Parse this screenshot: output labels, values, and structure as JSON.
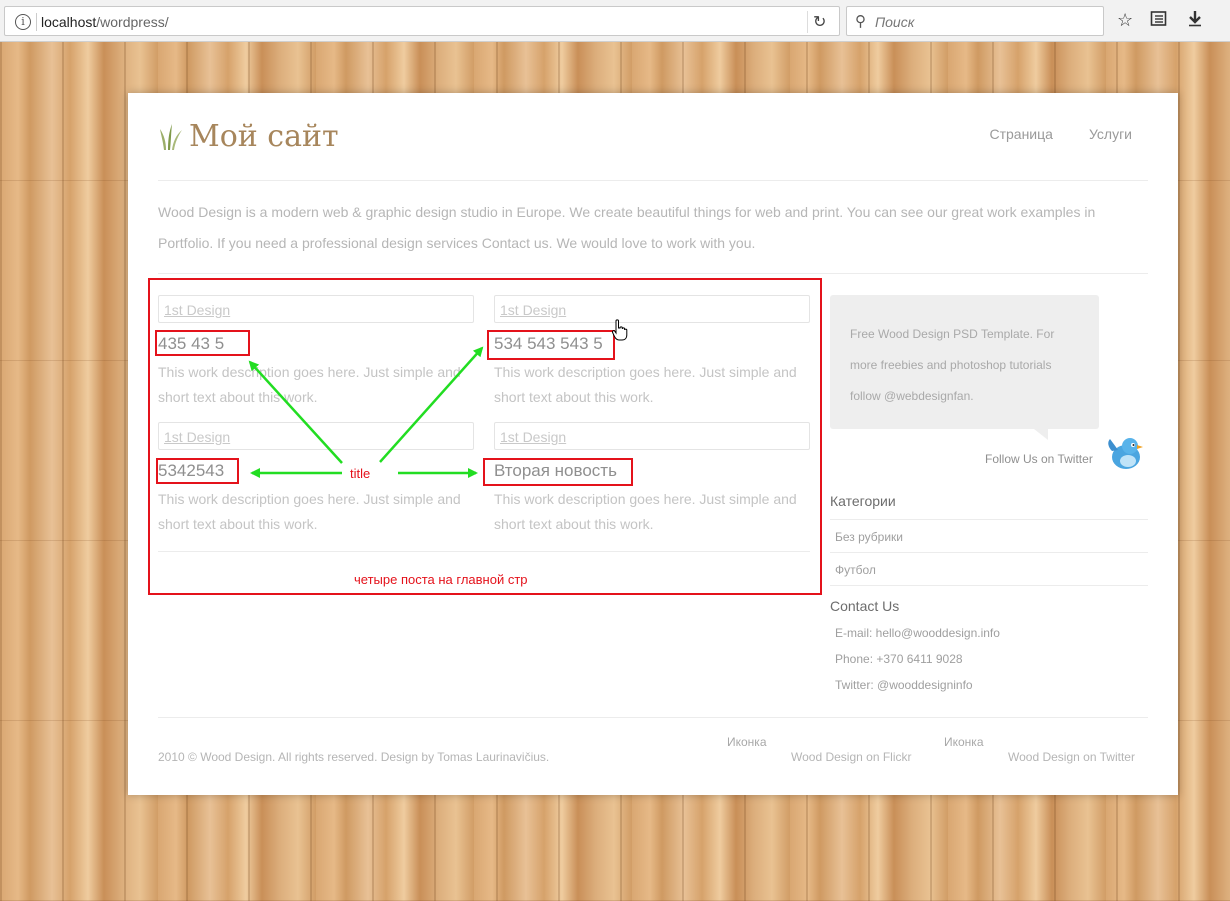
{
  "browser": {
    "url_host": "localhost",
    "url_path": "/wordpress/",
    "search_placeholder": "Поиск",
    "info_glyph": "i",
    "reload_glyph": "↻",
    "search_glyph": "⚲",
    "icons": [
      "star-icon",
      "reading-list-icon",
      "download-icon"
    ]
  },
  "site": {
    "title": "Мой сайт",
    "nav": [
      "Страница",
      "Услуги"
    ],
    "intro": "Wood Design is a modern web & graphic design studio in Europe. We create beautiful things for web and print. You can see our great work examples in Portfolio. If you need a professional design services Contact us. We would love to work with you."
  },
  "posts": [
    {
      "image_alt": "1st Design",
      "title": "435 43 5",
      "desc": "This work description goes here. Just simple and short text about this work."
    },
    {
      "image_alt": "1st Design",
      "title": "534 543 543 5",
      "desc": "This work description goes here. Just simple and short text about this work."
    },
    {
      "image_alt": "1st Design",
      "title": "5342543",
      "desc": "This work description goes here. Just simple and short text about this work."
    },
    {
      "image_alt": "1st Design",
      "title": "Вторая новость",
      "desc": "This work description goes here. Just simple and short text about this work."
    }
  ],
  "annotations": {
    "title_label": "title",
    "posts_label": "четыре поста на главной стр",
    "highlight_color": "#e4121b",
    "arrow_color": "#22dd22"
  },
  "sidebar": {
    "twitter_bubble": "Free Wood Design PSD Template. For more freebies and photoshop tutorials follow @webdesignfan.",
    "follow": "Follow Us on Twitter",
    "categories_head": "Категории",
    "categories": [
      "Без рубрики",
      "Футбол"
    ],
    "contact_head": "Contact Us",
    "contact": [
      "E-mail: hello@wooddesign.info",
      "Phone: +370 6411 9028",
      "Twitter: @wooddesigninfo"
    ]
  },
  "footer": {
    "copyright": "2010 © Wood Design. All rights reserved. Design by Tomas Laurinavičius.",
    "icon_alt_1": "Иконка",
    "link_1": "Wood Design on Flickr",
    "icon_alt_2": "Иконка",
    "link_2": "Wood Design on Twitter"
  },
  "colors": {
    "logo": "#a7865c",
    "wood": "#d9a772"
  }
}
